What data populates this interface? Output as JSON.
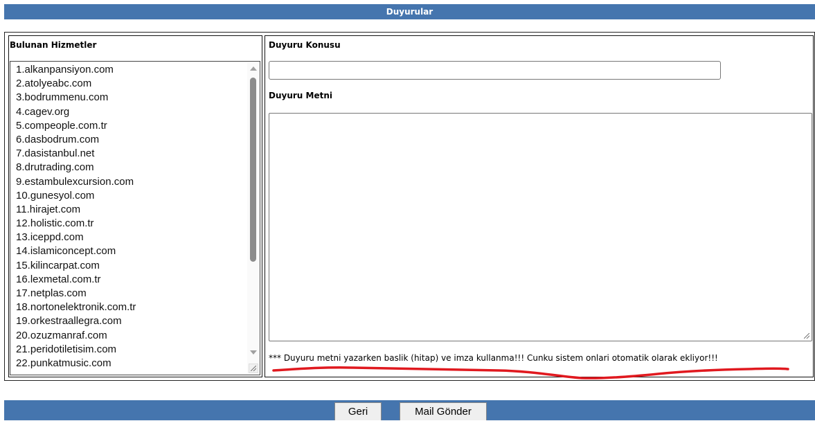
{
  "header": {
    "title": "Duyurular"
  },
  "services_panel": {
    "heading": "Bulunan Hizmetler",
    "items": [
      "1.alkanpansiyon.com",
      "2.atolyeabc.com",
      "3.bodrummenu.com",
      "4.cagev.org",
      "5.compeople.com.tr",
      "6.dasbodrum.com",
      "7.dasistanbul.net",
      "8.drutrading.com",
      "9.estambulexcursion.com",
      "10.gunesyol.com",
      "11.hirajet.com",
      "12.holistic.com.tr",
      "13.iceppd.com",
      "14.islamiconcept.com",
      "15.kilincarpat.com",
      "16.lexmetal.com.tr",
      "17.netplas.com",
      "18.nortonelektronik.com.tr",
      "19.orkestraallegra.com",
      "20.ozuzmanraf.com",
      "21.peridotiletisim.com",
      "22.punkatmusic.com"
    ]
  },
  "form": {
    "subject_label": "Duyuru Konusu",
    "subject_value": "",
    "body_label": "Duyuru Metni",
    "body_value": "",
    "note": "*** Duyuru metni yazarken baslik (hitap) ve imza kullanma!!! Cunku sistem onlari otomatik olarak ekliyor!!!"
  },
  "footer": {
    "back_label": "Geri",
    "send_label": "Mail Gönder"
  },
  "colors": {
    "bar": "#4575ae",
    "annotation": "#e0191f"
  }
}
